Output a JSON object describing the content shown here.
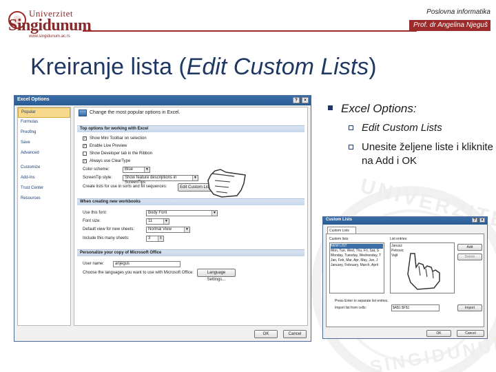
{
  "header": {
    "logo_top": "Univerzitet",
    "logo_main": "Singidunum",
    "logo_url": "www.singidunum.ac.rs",
    "course": "Poslovna informatika",
    "author": "Prof. dr Angelina Njeguš"
  },
  "title": {
    "plain": "Kreiranje lista (",
    "italic": "Edit Custom Lists",
    "close": ")"
  },
  "bullets": {
    "main": "Excel Options:",
    "sub1": "Edit Custom Lists",
    "sub2": "Unesite željene liste i kliknite na Add i OK"
  },
  "watermark": {
    "top": "UNIVERZITET",
    "bottom": "SINGIDUNUM"
  },
  "excel_options": {
    "title": "Excel Options",
    "sidebar": [
      "Popular",
      "Formulas",
      "Proofing",
      "Save",
      "Advanced",
      "Customize",
      "Add-Ins",
      "Trust Center",
      "Resources"
    ],
    "heading": "Change the most popular options in Excel.",
    "sec_top": "Top options for working with Excel",
    "opt1": "Show Mini Toolbar on selection",
    "opt2": "Enable Live Preview",
    "opt3": "Show Developer tab in the Ribbon",
    "opt4": "Always use ClearType",
    "color_label": "Color scheme:",
    "color_value": "Blue",
    "tip_label": "ScreenTip style:",
    "tip_value": "Show feature descriptions in ScreenTips",
    "lists_label": "Create lists for use in sorts and fill sequences:",
    "lists_button": "Edit Custom Lists...",
    "sec_new": "When creating new workbooks",
    "font_label": "Use this font:",
    "font_value": "Body Font",
    "size_label": "Font size:",
    "size_value": "11",
    "view_label": "Default view for new sheets:",
    "view_value": "Normal View",
    "sheets_label": "Include this many sheets:",
    "sheets_value": "3",
    "sec_personal": "Personalize your copy of Microsoft Office",
    "user_label": "User name:",
    "user_value": "anjegus",
    "lang_label": "Choose the languages you want to use with Microsoft Office:",
    "lang_button": "Language Settings...",
    "ok": "OK",
    "cancel": "Cancel"
  },
  "custom_lists": {
    "title": "Custom Lists",
    "tab": "Custom Lists",
    "lists_label": "Custom lists:",
    "entries_label": "List entries:",
    "lists": [
      "NEW LIST",
      "Mon, Tue, Wed, Thu, Fri, Sat, S",
      "Monday, Tuesday, Wednesday, T",
      "Jan, Feb, Mar, Apr, May, Jun, J",
      "January, February, March, April"
    ],
    "entries": [
      "Janusz",
      "Petrovic",
      "Vajit"
    ],
    "add": "Add",
    "delete": "Delete",
    "import_label": "Press Enter to separate list entries.",
    "import_from": "Import list from cells:",
    "import_ref": "$A$1:$F$1",
    "import": "Import",
    "ok": "OK",
    "cancel": "Cancel"
  }
}
